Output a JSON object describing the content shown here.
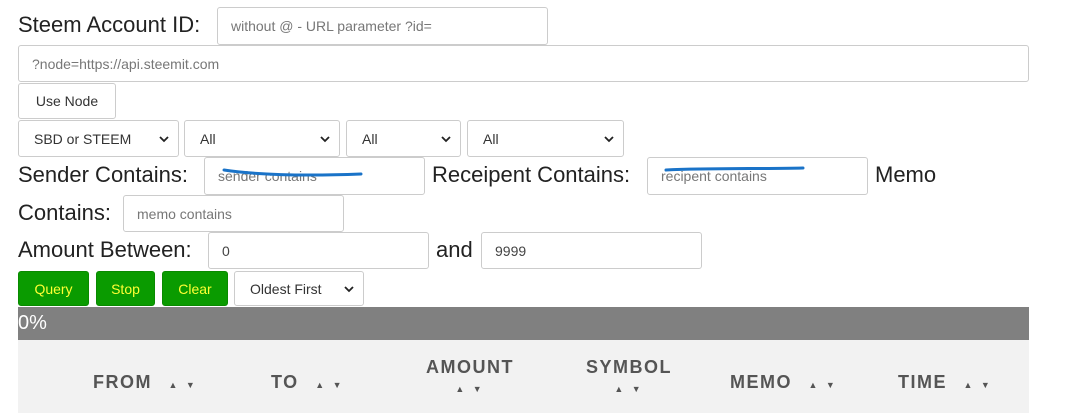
{
  "account": {
    "label": "Steem Account ID:",
    "placeholder": "without @ - URL parameter ?id="
  },
  "node": {
    "placeholder": "?node=https://api.steemit.com",
    "use_button": "Use Node"
  },
  "filters": {
    "currency": "SBD or STEEM",
    "type": "All",
    "direction": "All",
    "status": "All"
  },
  "sender": {
    "label": "Sender Contains:",
    "placeholder": "sender contains"
  },
  "recipient": {
    "label": "Receipent Contains:",
    "placeholder": "recipent contains"
  },
  "memo": {
    "label_part1": "Memo",
    "label_part2": "Contains:",
    "placeholder": "memo contains"
  },
  "amount": {
    "label": "Amount Between:",
    "min": "0",
    "and": "and",
    "max": "9999"
  },
  "actions": {
    "query": "Query",
    "stop": "Stop",
    "clear": "Clear",
    "sort": "Oldest First"
  },
  "progress": {
    "text": "0%",
    "value": 0
  },
  "table": {
    "columns": [
      {
        "label": "FROM"
      },
      {
        "label": "TO"
      },
      {
        "label": "AMOUNT"
      },
      {
        "label": "SYMBOL"
      },
      {
        "label": "MEMO"
      },
      {
        "label": "TIME"
      }
    ],
    "sort_arrows": "▲ ▼"
  },
  "colors": {
    "action_green": "#0a9b00",
    "action_text": "#ffff33",
    "progress_bg": "#808080",
    "scribble_blue": "#1a73c8"
  }
}
